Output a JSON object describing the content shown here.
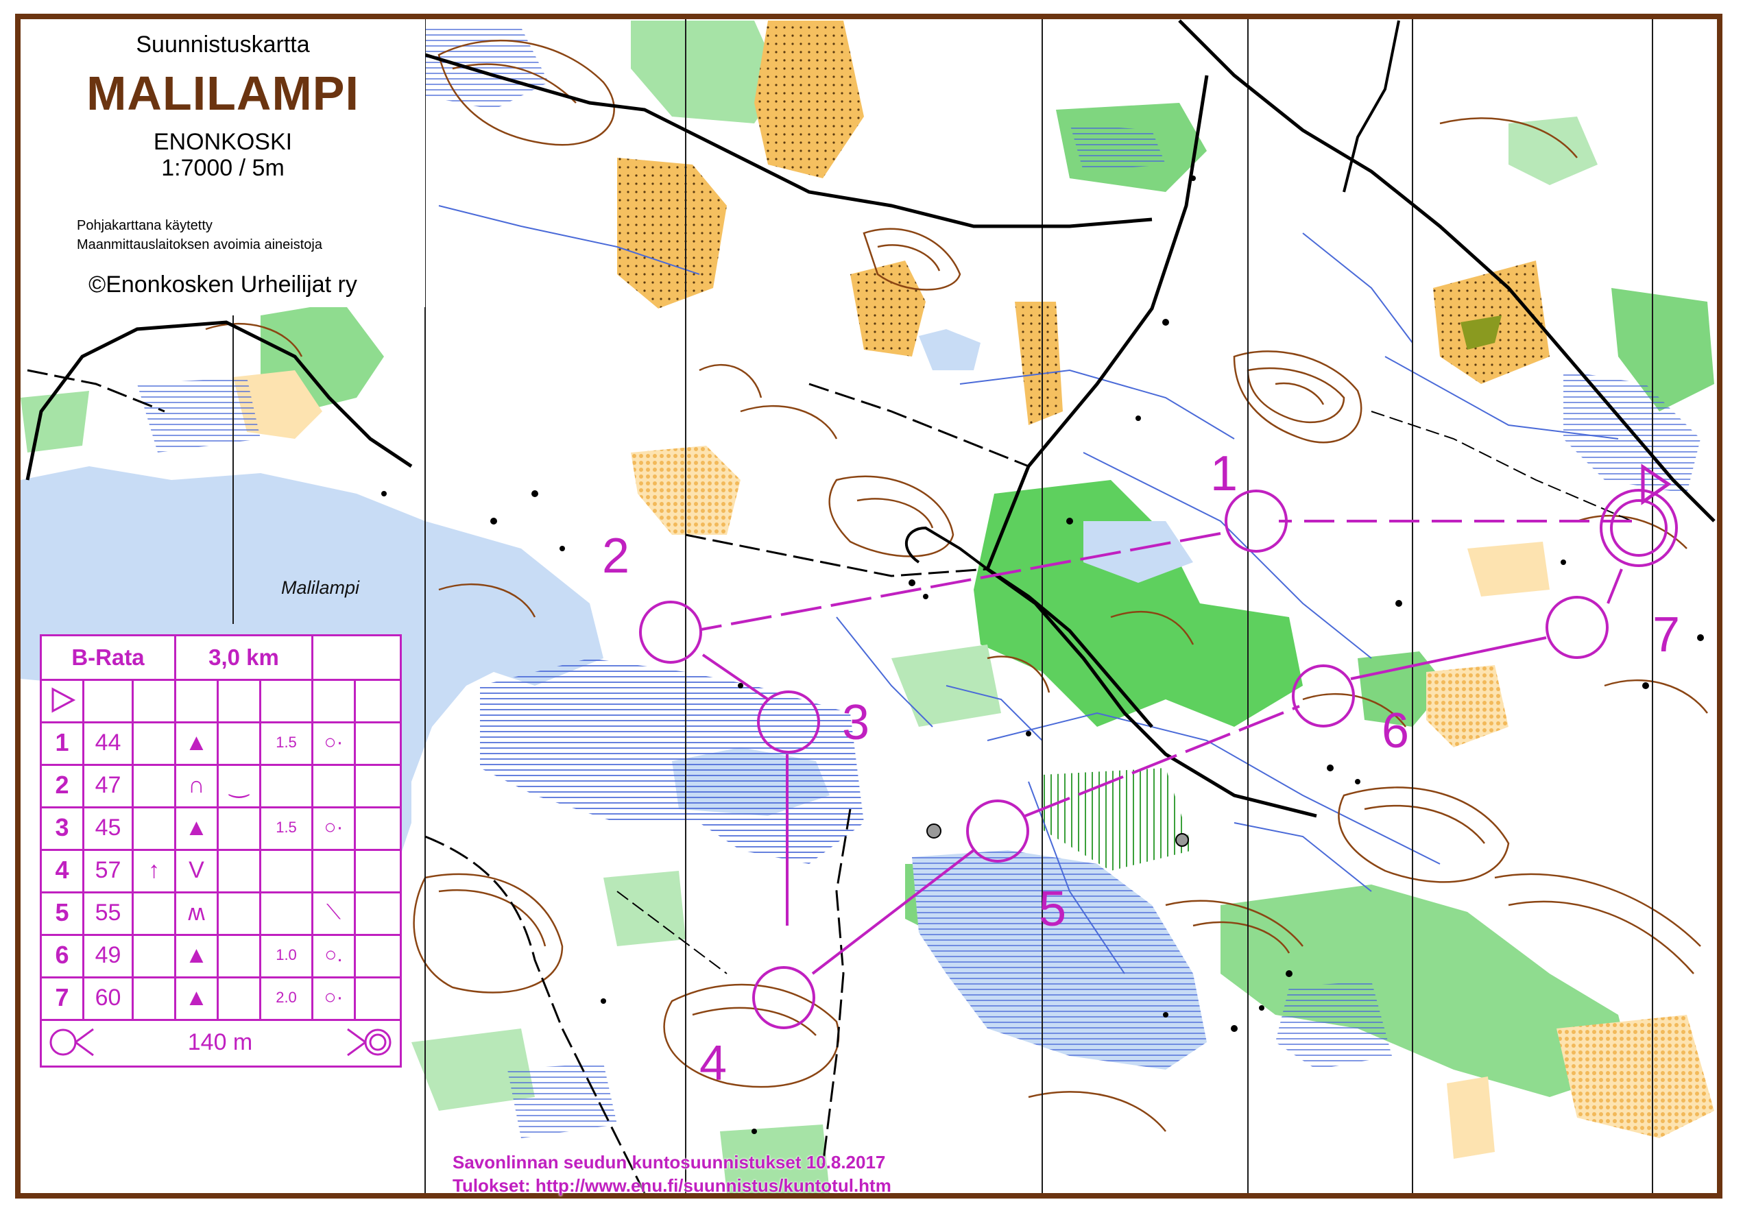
{
  "map": {
    "kind": "Suunnistuskartta",
    "name": "MALILAMPI",
    "place": "ENONKOSKI",
    "scale": "1:7000 / 5m",
    "credit_line1": "Pohjakarttana käytetty",
    "credit_line2": "Maanmittauslaitoksen avoimia aineistoja",
    "copyright": "©Enonkosken Urheilijat ry",
    "lake_label": "Malilampi"
  },
  "course": {
    "name": "B-Rata",
    "length": "3,0 km",
    "start_symbol": "triangle",
    "controls": [
      {
        "num": "1",
        "code": "44",
        "c_col": "",
        "feature": "▲",
        "g_col": "",
        "size": "1.5",
        "position": "○·"
      },
      {
        "num": "2",
        "code": "47",
        "c_col": "",
        "feature": "∩",
        "g_col": "‿",
        "size": "",
        "position": ""
      },
      {
        "num": "3",
        "code": "45",
        "c_col": "",
        "feature": "▲",
        "g_col": "",
        "size": "1.5",
        "position": "○·"
      },
      {
        "num": "4",
        "code": "57",
        "c_col": "↑",
        "feature": "V",
        "g_col": "",
        "size": "",
        "position": ""
      },
      {
        "num": "5",
        "code": "55",
        "c_col": "",
        "feature": "ʍ",
        "g_col": "",
        "size": "",
        "position": "⟍"
      },
      {
        "num": "6",
        "code": "49",
        "c_col": "",
        "feature": "▲",
        "g_col": "",
        "size": "1.0",
        "position": "○."
      },
      {
        "num": "7",
        "code": "60",
        "c_col": "",
        "feature": "▲",
        "g_col": "",
        "size": "2.0",
        "position": "○·"
      }
    ],
    "finish_distance": "140 m",
    "map_labels": [
      "1",
      "2",
      "3",
      "4",
      "5",
      "6",
      "7"
    ]
  },
  "footer": {
    "line1": "Savonlinnan seudun kuntosuunnistukset 10.8.2017",
    "line2": "Tulokset: http://www.enu.fi/suunnistus/kuntotul.htm"
  },
  "colors": {
    "course": "#c020c0",
    "contour": "#8b4513",
    "water": "#c8dcf5",
    "vegetation": "#8fdc8f",
    "open_land": "#f5c060"
  }
}
